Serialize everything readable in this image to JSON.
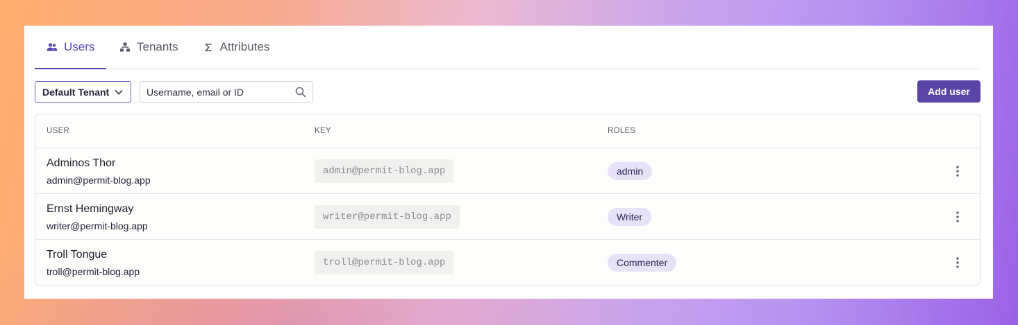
{
  "tabs": [
    {
      "label": "Users",
      "icon": "users-icon",
      "active": true
    },
    {
      "label": "Tenants",
      "icon": "hierarchy-icon",
      "active": false
    },
    {
      "label": "Attributes",
      "icon": "sigma-icon",
      "active": false
    }
  ],
  "toolbar": {
    "tenant_select": "Default Tenant",
    "search_placeholder": "Username, email or ID",
    "search_value": "",
    "add_user_label": "Add user"
  },
  "table": {
    "columns": [
      "USER",
      "KEY",
      "ROLES"
    ],
    "rows": [
      {
        "name": "Adminos Thor",
        "email": "admin@permit-blog.app",
        "key": "admin@permit-blog.app",
        "role": "admin"
      },
      {
        "name": "Ernst Hemingway",
        "email": "writer@permit-blog.app",
        "key": "writer@permit-blog.app",
        "role": "Writer"
      },
      {
        "name": "Troll Tongue",
        "email": "troll@permit-blog.app",
        "key": "troll@permit-blog.app",
        "role": "Commenter"
      }
    ]
  },
  "colors": {
    "accent": "#5b46b3",
    "button": "#5a44a8",
    "role_badge_bg": "#e8e2f9",
    "key_pill_bg": "#f0f0ee"
  }
}
